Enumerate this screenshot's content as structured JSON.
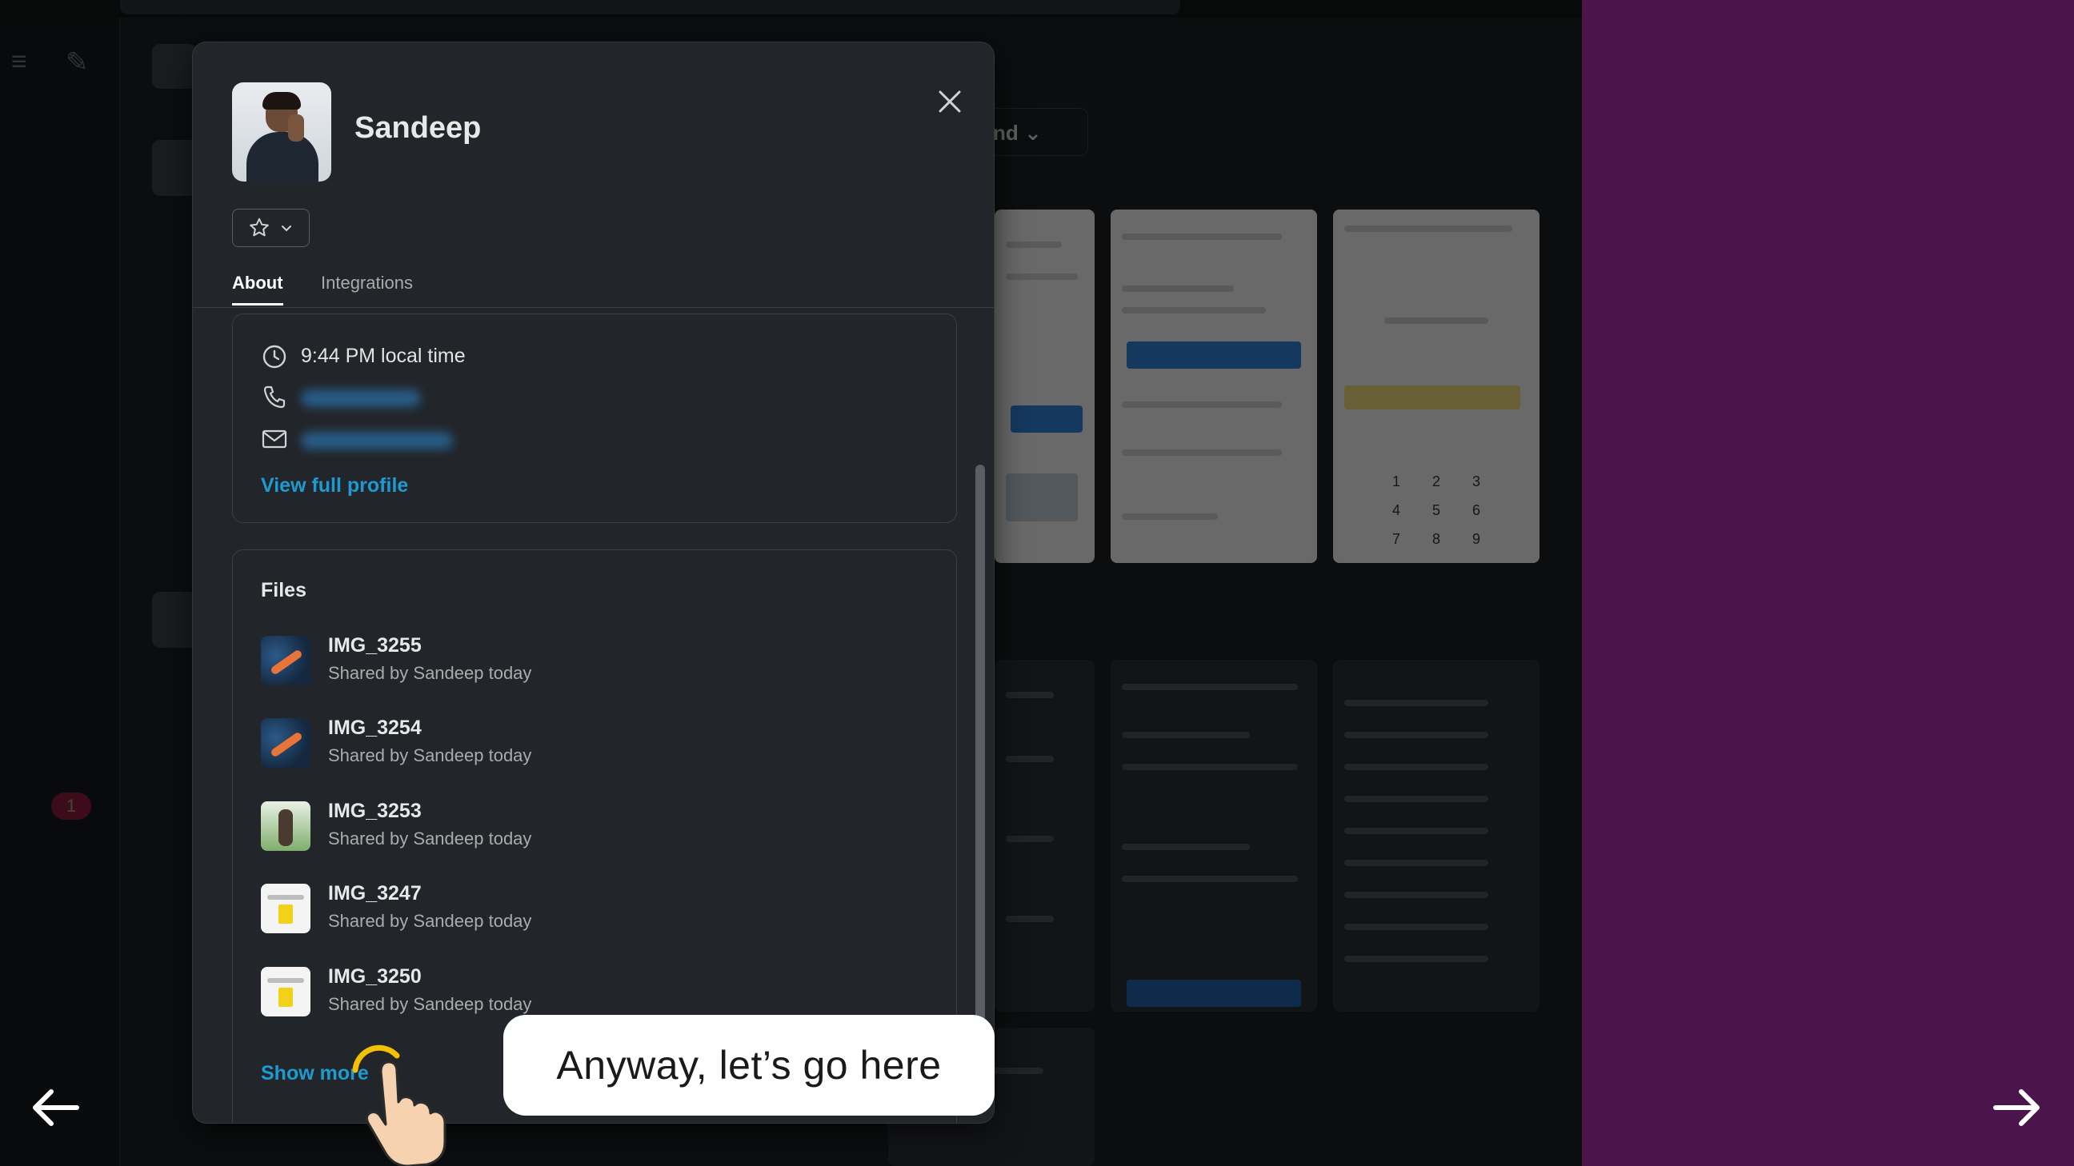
{
  "profile": {
    "name": "Sandeep",
    "favorite_icon": "star-icon",
    "tabs": [
      {
        "label": "About",
        "active": true
      },
      {
        "label": "Integrations",
        "active": false
      }
    ],
    "about": {
      "local_time": "9:44 PM local time",
      "phone": "",
      "email": "",
      "view_profile_label": "View full profile"
    },
    "files": {
      "title": "Files",
      "items": [
        {
          "name": "IMG_3255",
          "subtitle": "Shared by Sandeep today",
          "thumb": "map"
        },
        {
          "name": "IMG_3254",
          "subtitle": "Shared by Sandeep today",
          "thumb": "map"
        },
        {
          "name": "IMG_3253",
          "subtitle": "Shared by Sandeep today",
          "thumb": "photo"
        },
        {
          "name": "IMG_3247",
          "subtitle": "Shared by Sandeep today",
          "thumb": "doc"
        },
        {
          "name": "IMG_3250",
          "subtitle": "Shared by Sandeep today",
          "thumb": "doc"
        }
      ],
      "show_more_label": "Show more"
    }
  },
  "background": {
    "pill_label": "nd",
    "badge_count": "1",
    "keypad": [
      "1",
      "2",
      "3",
      "4",
      "5",
      "6",
      "7",
      "8",
      "9"
    ]
  },
  "tutorial": {
    "callout_text": "Anyway, let’s go here",
    "prev_icon": "arrow-left-icon",
    "next_icon": "arrow-right-icon"
  },
  "colors": {
    "modal_bg": "#222529",
    "link": "#1d9bd1",
    "side_panel": "#4a154b"
  }
}
